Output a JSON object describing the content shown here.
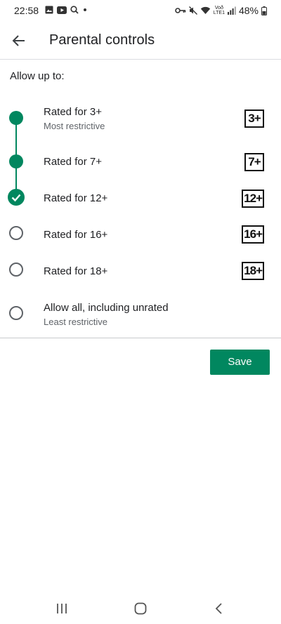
{
  "status_bar": {
    "time": "22:58",
    "battery": "48%",
    "network_top": "Voð",
    "network_bottom": "LTE1",
    "icons": [
      "image-icon",
      "youtube-icon",
      "search-icon",
      "dot-icon",
      "key-icon",
      "mute-icon",
      "wifi-icon",
      "signal-icon",
      "battery-icon"
    ]
  },
  "app_bar": {
    "title": "Parental controls",
    "back_icon": "back-arrow-icon"
  },
  "intro": "Allow up to:",
  "options": [
    {
      "label": "Rated for 3+",
      "sublabel": "Most restrictive",
      "badge": "3+",
      "state": "included"
    },
    {
      "label": "Rated for 7+",
      "sublabel": "",
      "badge": "7+",
      "state": "included"
    },
    {
      "label": "Rated for 12+",
      "sublabel": "",
      "badge": "12+",
      "state": "selected"
    },
    {
      "label": "Rated for 16+",
      "sublabel": "",
      "badge": "16+",
      "state": "unselected"
    },
    {
      "label": "Rated for 18+",
      "sublabel": "",
      "badge": "18+",
      "state": "unselected"
    },
    {
      "label": "Allow all, including unrated",
      "sublabel": "Least restrictive",
      "badge": "",
      "state": "unselected"
    }
  ],
  "save_label": "Save",
  "colors": {
    "accent": "#01875f",
    "text": "#202124",
    "secondary_text": "#5f6368"
  },
  "nav_bar": {
    "icons": [
      "recents-icon",
      "home-icon",
      "back-icon"
    ]
  }
}
